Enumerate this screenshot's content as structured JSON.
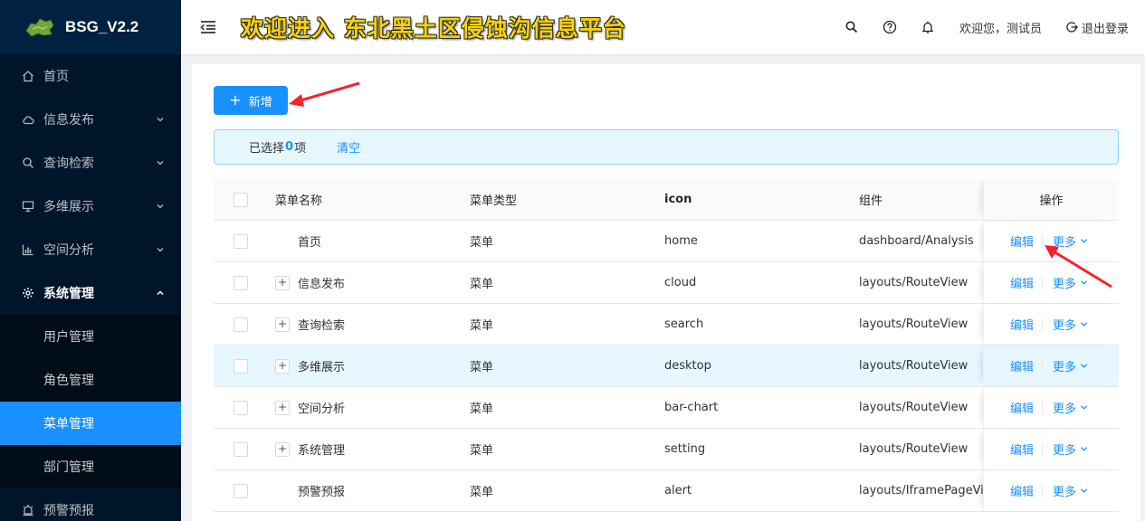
{
  "app": {
    "title": "BSG_V2.2",
    "banner": "欢迎进入 东北黑土区侵蚀沟信息平台"
  },
  "sidebar": {
    "items": [
      {
        "label": "首页",
        "icon": "home-icon"
      },
      {
        "label": "信息发布",
        "icon": "cloud-icon"
      },
      {
        "label": "查询检索",
        "icon": "search-icon"
      },
      {
        "label": "多维展示",
        "icon": "desktop-icon"
      },
      {
        "label": "空间分析",
        "icon": "bar-chart-icon"
      },
      {
        "label": "系统管理",
        "icon": "setting-icon"
      },
      {
        "label": "预警预报",
        "icon": "alert-icon"
      }
    ],
    "submenu": [
      "用户管理",
      "角色管理",
      "菜单管理",
      "部门管理"
    ],
    "active_sub": "菜单管理"
  },
  "header": {
    "welcome": "欢迎您，测试员",
    "logout": "退出登录"
  },
  "toolbar": {
    "add_label": "新增"
  },
  "selection": {
    "prefix": "已选择 ",
    "count": "0",
    "suffix": "项",
    "clear": "清空"
  },
  "table": {
    "columns": [
      "菜单名称",
      "菜单类型",
      "icon",
      "组件",
      "操作"
    ],
    "rows": [
      {
        "name": "首页",
        "type": "菜单",
        "icon": "home",
        "component": "dashboard/Analysis",
        "expandable": false
      },
      {
        "name": "信息发布",
        "type": "菜单",
        "icon": "cloud",
        "component": "layouts/RouteView",
        "expandable": true
      },
      {
        "name": "查询检索",
        "type": "菜单",
        "icon": "search",
        "component": "layouts/RouteView",
        "expandable": true
      },
      {
        "name": "多维展示",
        "type": "菜单",
        "icon": "desktop",
        "component": "layouts/RouteView",
        "expandable": true
      },
      {
        "name": "空间分析",
        "type": "菜单",
        "icon": "bar-chart",
        "component": "layouts/RouteView",
        "expandable": true
      },
      {
        "name": "系统管理",
        "type": "菜单",
        "icon": "setting",
        "component": "layouts/RouteView",
        "expandable": true
      },
      {
        "name": "预警预报",
        "type": "菜单",
        "icon": "alert",
        "component": "layouts/IframePageView",
        "expandable": false
      }
    ],
    "row_actions": {
      "edit": "编辑",
      "more": "更多"
    },
    "expand_symbol": "+"
  },
  "colors": {
    "sidebar_bg": "#001529",
    "primary": "#1890ff",
    "banner_yellow": "#f5d20a",
    "annotation_red": "#f5222d"
  }
}
